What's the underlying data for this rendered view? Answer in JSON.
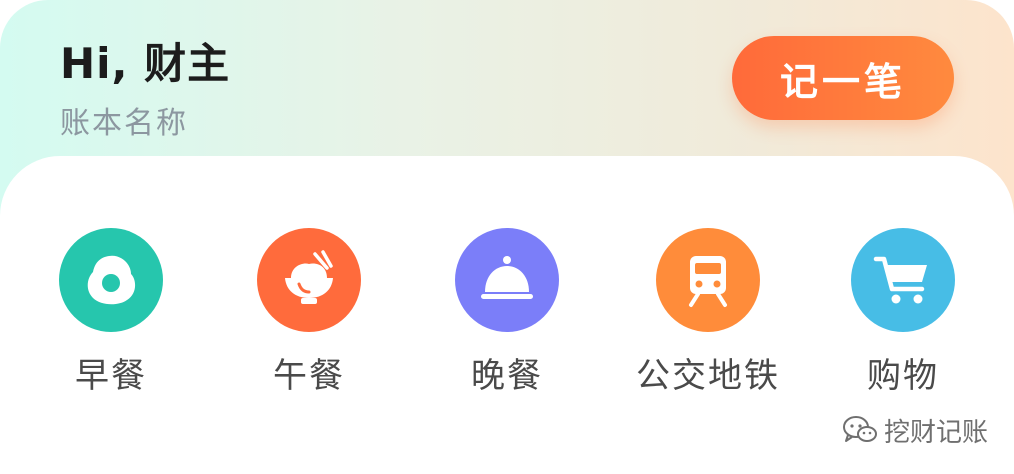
{
  "header": {
    "greeting": "Hi, 财主",
    "ledger_name": "账本名称",
    "record_button_label": "记一笔"
  },
  "categories": [
    {
      "label": "早餐",
      "icon": "fried-egg-icon",
      "color": "#26c6ad"
    },
    {
      "label": "午餐",
      "icon": "rice-bowl-icon",
      "color": "#ff6b3c"
    },
    {
      "label": "晚餐",
      "icon": "dinner-cloche-icon",
      "color": "#7b7ef9"
    },
    {
      "label": "公交地铁",
      "icon": "subway-train-icon",
      "color": "#ff8c3a"
    },
    {
      "label": "购物",
      "icon": "shopping-cart-icon",
      "color": "#47bde6"
    }
  ],
  "watermark": {
    "text": "挖财记账",
    "icon": "wechat-icon"
  },
  "colors": {
    "accent": "#ff6a3a",
    "ledger_text": "#8c97a0"
  }
}
